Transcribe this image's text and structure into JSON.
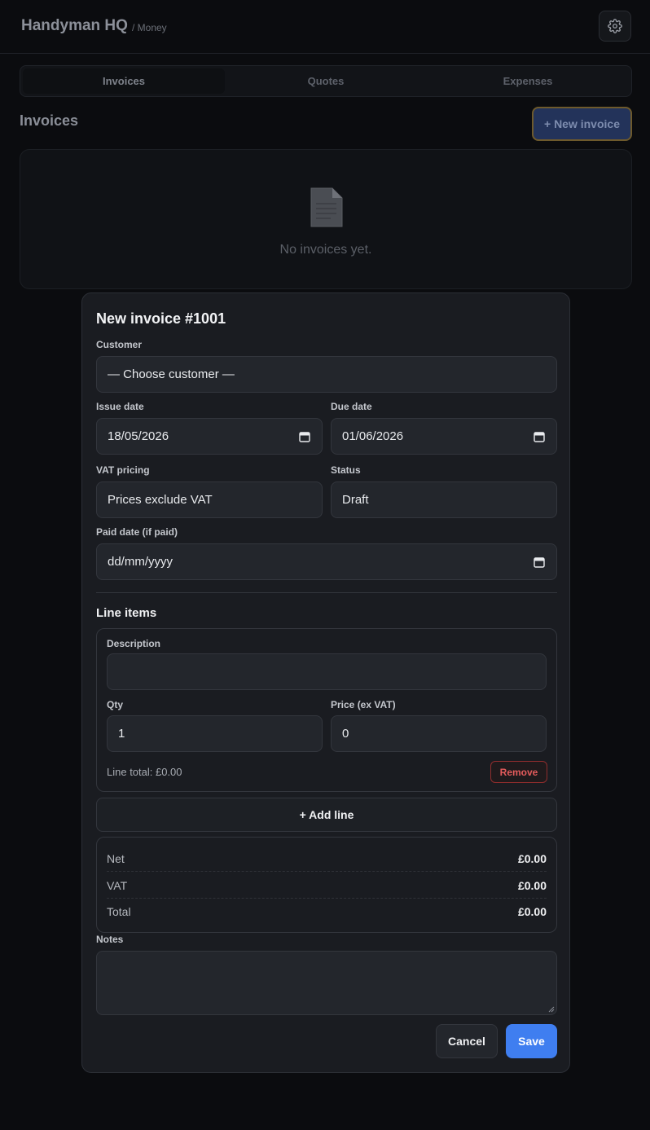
{
  "header": {
    "brand": "Handyman HQ",
    "breadcrumb": "/ Money"
  },
  "tabs": [
    {
      "label": "Invoices",
      "active": true
    },
    {
      "label": "Quotes",
      "active": false
    },
    {
      "label": "Expenses",
      "active": false
    }
  ],
  "invoices": {
    "title": "Invoices",
    "new_button": "+ New invoice",
    "empty_text": "No invoices yet."
  },
  "modal": {
    "title": "New invoice #1001",
    "customer": {
      "label": "Customer",
      "value": "— Choose customer —"
    },
    "issue_date": {
      "label": "Issue date",
      "value": "18/05/2026"
    },
    "due_date": {
      "label": "Due date",
      "value": "01/06/2026"
    },
    "vat_pricing": {
      "label": "VAT pricing",
      "value": "Prices exclude VAT"
    },
    "status": {
      "label": "Status",
      "value": "Draft"
    },
    "paid_date": {
      "label": "Paid date (if paid)",
      "value": "dd/mm/yyyy"
    },
    "line_items": {
      "title": "Line items",
      "items": [
        {
          "description_label": "Description",
          "description_value": "",
          "qty_label": "Qty",
          "qty_value": "1",
          "price_label": "Price (ex VAT)",
          "price_value": "0",
          "line_total": "Line total: £0.00",
          "remove_label": "Remove"
        }
      ],
      "add_line": "+ Add line"
    },
    "totals": {
      "net_label": "Net",
      "net_value": "£0.00",
      "vat_label": "VAT",
      "vat_value": "£0.00",
      "total_label": "Total",
      "total_value": "£0.00"
    },
    "notes_label": "Notes",
    "notes_value": "",
    "cancel": "Cancel",
    "save": "Save"
  },
  "colors": {
    "accent": "#3f7ef0",
    "danger": "#e35b5b",
    "surface": "#1a1c21"
  },
  "icons": [
    "gear-icon",
    "document-icon",
    "calendar-icon",
    "resize-handle-icon"
  ]
}
